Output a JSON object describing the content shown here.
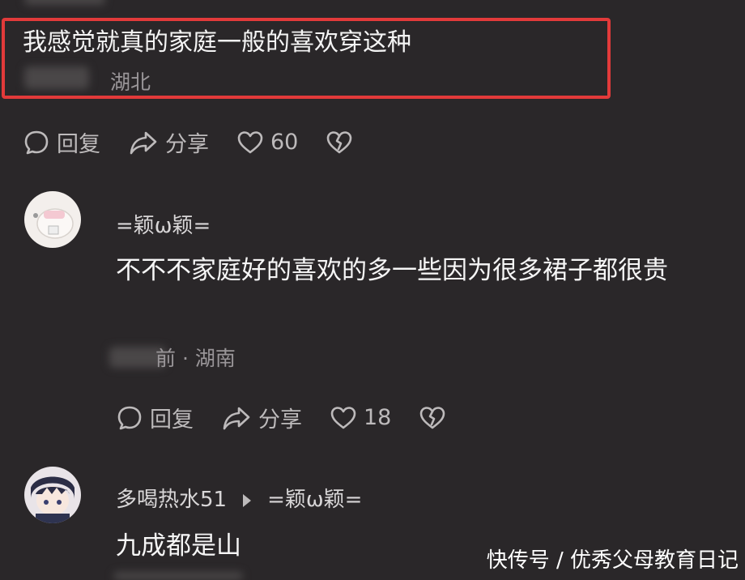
{
  "comment1": {
    "text": "我感觉就真的家庭一般的喜欢穿这种",
    "location": "湖北",
    "actions": {
      "reply": "回复",
      "share": "分享",
      "likes": "60"
    }
  },
  "comment2": {
    "username": "=颖ω颖=",
    "text": "不不不家庭好的喜欢的多一些因为很多裙子都很贵",
    "time_suffix": "前",
    "location": "· 湖南",
    "actions": {
      "reply": "回复",
      "share": "分享",
      "likes": "18"
    }
  },
  "comment3": {
    "username": "多喝热水51",
    "reply_to": "=颖ω颖=",
    "text": "九成都是山"
  },
  "watermark": "快传号 / 优秀父母教育日记",
  "colors": {
    "background": "#2a2729",
    "highlight": "#e23a3a",
    "secondary_text": "#9a9699"
  },
  "icons": [
    "comment-bubble-icon",
    "share-arrow-icon",
    "heart-icon",
    "broken-heart-icon",
    "reply-triangle-icon"
  ]
}
